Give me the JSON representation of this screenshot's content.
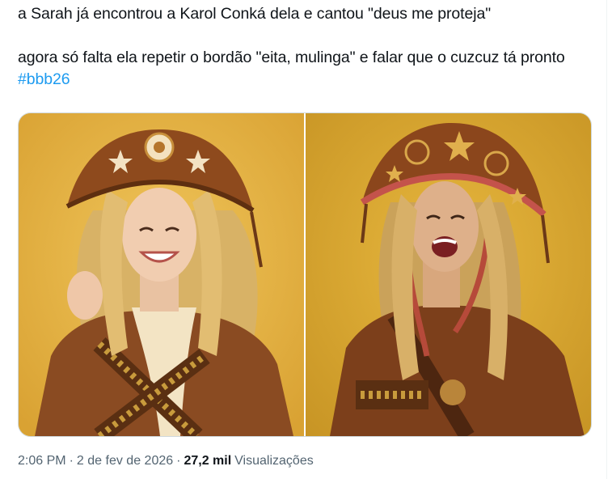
{
  "tweet": {
    "line1": "a Sarah já encontrou a Karol Conká dela e cantou \"deus me proteja\"",
    "line2": "agora só falta ela repetir o bordão \"eita, mulinga\" e falar que o cuzcuz tá pronto",
    "hashtag": "#bbb26"
  },
  "media": {
    "images": [
      {
        "name": "left-photo"
      },
      {
        "name": "right-photo"
      }
    ]
  },
  "meta": {
    "time": "2:06 PM",
    "separator": "·",
    "date": "2 de fev de 2026",
    "views_count": "27,2 mil",
    "views_label": "Visualizações"
  },
  "colors": {
    "link": "#1d9bf0",
    "secondary_text": "#536471",
    "photo_background": "#e2b240",
    "leather": "#8a4b22"
  }
}
